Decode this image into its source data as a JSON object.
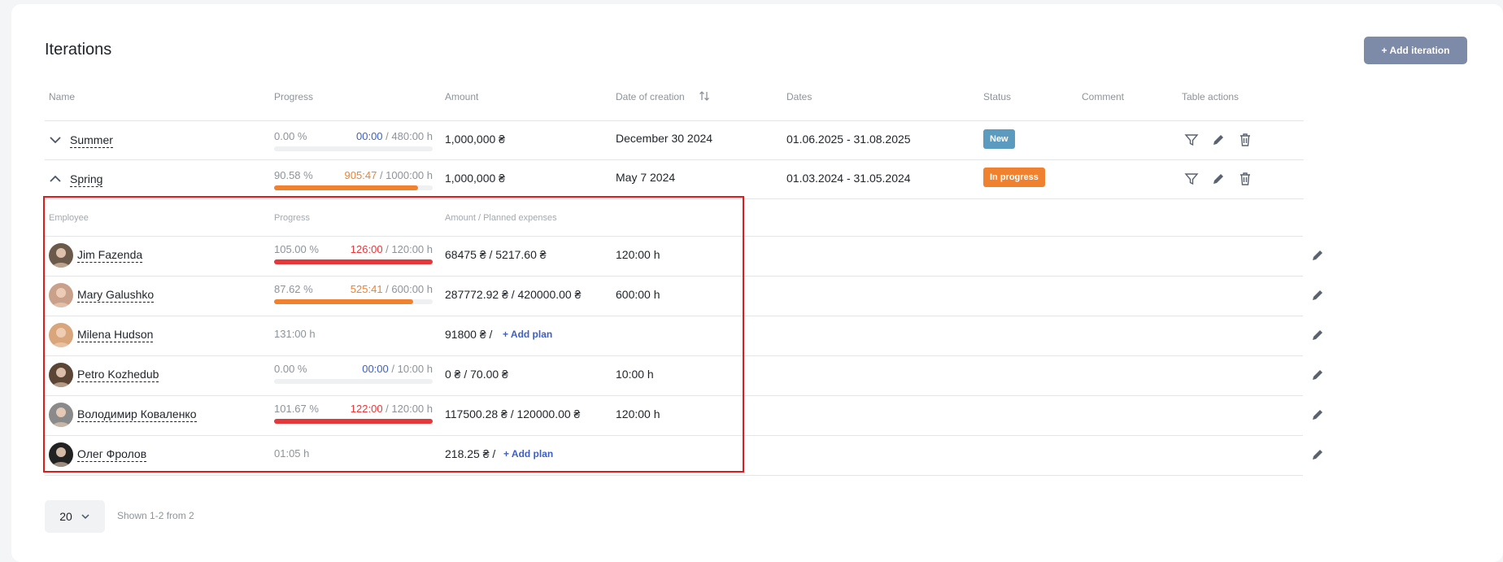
{
  "page": {
    "title": "Iterations",
    "add_button": "+ Add iteration"
  },
  "columns": {
    "name": "Name",
    "progress": "Progress",
    "amount": "Amount",
    "date_of_creation": "Date of creation",
    "dates": "Dates",
    "status": "Status",
    "comment": "Comment",
    "table_actions": "Table actions"
  },
  "iterations": [
    {
      "name": "Summer",
      "progress_pct": "0.00 %",
      "time_spent": "00:00",
      "time_total": "/ 480:00 h",
      "progress_value": 0,
      "amount": "1,000,000 ₴",
      "created": "December 30 2024",
      "dates": "01.06.2025 - 31.08.2025",
      "status": "New",
      "status_color": "#5b9bbf"
    },
    {
      "name": "Spring",
      "progress_pct": "90.58 %",
      "time_spent": "905:47",
      "time_total": "/ 1000:00 h",
      "progress_value": 0.9058,
      "amount": "1,000,000 ₴",
      "created": "May 7 2024",
      "dates": "01.03.2024 - 31.05.2024",
      "status": "In progress",
      "status_color": "#f0812e"
    }
  ],
  "sub_columns": {
    "employee": "Employee",
    "progress": "Progress",
    "amount": "Amount / Planned expenses"
  },
  "employees": [
    {
      "name": "Jim Fazenda",
      "progress_pct": "105.00 %",
      "time_spent": "126:00",
      "time_total": "/ 120:00 h",
      "progress_value": 1.05,
      "amount": "68475 ₴ / 5217.60 ₴",
      "hours": "120:00 h"
    },
    {
      "name": "Mary Galushko",
      "progress_pct": "87.62 %",
      "time_spent": "525:41",
      "time_total": "/ 600:00 h",
      "progress_value": 0.8762,
      "amount": "287772.92 ₴ / 420000.00 ₴",
      "hours": "600:00 h"
    },
    {
      "name": "Milena Hudson",
      "time_only": "131:00 h",
      "amount": "91800 ₴ /",
      "add_plan": "+ Add plan"
    },
    {
      "name": "Petro Kozhedub",
      "progress_pct": "0.00 %",
      "time_spent": "00:00",
      "time_total": "/ 10:00 h",
      "progress_value": 0,
      "amount": "0 ₴ / 70.00 ₴",
      "hours": "10:00 h"
    },
    {
      "name": "Володимир Коваленко",
      "progress_pct": "101.67 %",
      "time_spent": "122:00",
      "time_total": "/ 120:00 h",
      "progress_value": 1.0167,
      "amount": "117500.28 ₴ / 120000.00 ₴",
      "hours": "120:00 h"
    },
    {
      "name": "Олег Фролов",
      "time_only": "01:05 h",
      "amount": "218.25 ₴ /",
      "add_plan": "+ Add plan"
    }
  ],
  "pagination": {
    "page_size": "20",
    "shown": "Shown 1-2 from 2"
  },
  "colors": {
    "over": "#e5383b",
    "partial": "#f0812e",
    "zero": "#3d5fc4",
    "status_new": "#5b9bbf",
    "status_in_progress": "#f0812e"
  }
}
